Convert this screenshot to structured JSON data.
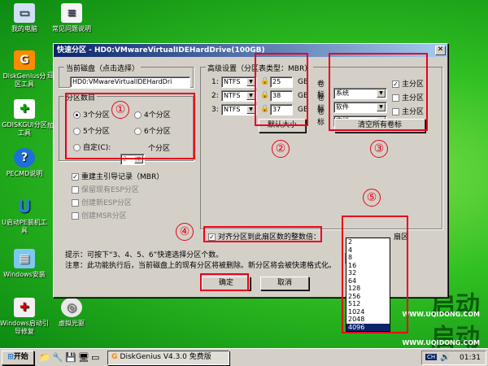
{
  "desktop": {
    "icons": [
      {
        "label": "我的电脑",
        "icon": "computer-icon"
      },
      {
        "label": "常见问题说明",
        "icon": "document-icon"
      },
      {
        "label": "DiskGenius分区工具",
        "icon": "diskgenius-icon"
      },
      {
        "label": "GDISKGUI分区工具",
        "icon": "gdisk-icon"
      },
      {
        "label": "PECMD说明",
        "icon": "help-icon"
      },
      {
        "label": "U启动PE装机工具",
        "icon": "installer-icon"
      },
      {
        "label": "Windows安装",
        "icon": "windows-setup-icon"
      },
      {
        "label": "Windows启动引导修复",
        "icon": "boot-repair-icon"
      },
      {
        "label": "虚拟光驱",
        "icon": "cdrom-icon"
      }
    ],
    "partial_labels": [
      "迎",
      "加"
    ],
    "brand": {
      "text1": "启动",
      "url1": "WWW.UQIDONG.COM",
      "text2": "启动",
      "url2": "WWW.UQIDONG.COM",
      "accent": "#0a5c0a"
    }
  },
  "dialog": {
    "title": "快速分区 - HD0:VMwareVirtualIDEHardDrive(100GB)",
    "close": "✕",
    "disk_group_label": "当前磁盘（点击选择）",
    "disk_value": "HD0:VMwareVirtualIDEHardDri",
    "partcount": {
      "label": "分区数目",
      "opt3": "3个分区",
      "opt4": "4个分区",
      "opt5": "5个分区",
      "opt6": "6个分区",
      "custom": "自定(C):",
      "custom_value": "2",
      "custom_suffix": "个分区",
      "selected": "3"
    },
    "options": {
      "rebuild_mbr": "重建主引导记录（MBR）",
      "keep_esp": "保留现有ESP分区",
      "create_esp": "创建新ESP分区",
      "create_msr": "创建MSR分区"
    },
    "adv": {
      "label": "高级设置（分区表类型：MBR）",
      "rows": [
        {
          "idx": "1:",
          "fs": "NTFS",
          "size": "25",
          "unit": "GB",
          "vol_label": "卷标",
          "vol": "系统",
          "primary": "主分区",
          "primary_checked": true
        },
        {
          "idx": "2:",
          "fs": "NTFS",
          "size": "38",
          "unit": "GB",
          "vol_label": "卷标",
          "vol": "软件",
          "primary": "主分区",
          "primary_checked": false
        },
        {
          "idx": "3:",
          "fs": "NTFS",
          "size": "37",
          "unit": "GB",
          "vol_label": "卷标",
          "vol": "文档",
          "primary": "主分区",
          "primary_checked": false
        }
      ],
      "default_size": "默认大小",
      "clear_labels": "清空所有卷标"
    },
    "align": {
      "label": "对齐分区到此扇区数的整数倍：",
      "checked": true,
      "value": "2048",
      "suffix": "扇区"
    },
    "hint1": "提示：可按下“3、4、5、6”快速选择分区个数。",
    "hint2": "注意：此功能执行后，当前磁盘上的现有分区将被删除。新分区将会被快速格式化。",
    "ok": "确定",
    "cancel": "取消",
    "dropdown_options": [
      "2",
      "4",
      "8",
      "16",
      "32",
      "64",
      "128",
      "256",
      "512",
      "1024",
      "2048",
      "4096"
    ],
    "dropdown_selected": "4096"
  },
  "annotations": [
    "①",
    "②",
    "③",
    "④",
    "⑤"
  ],
  "taskbar": {
    "start": "开始",
    "task": "DiskGenius V4.3.0 免费版",
    "lang": "CH",
    "time": "01:31"
  }
}
